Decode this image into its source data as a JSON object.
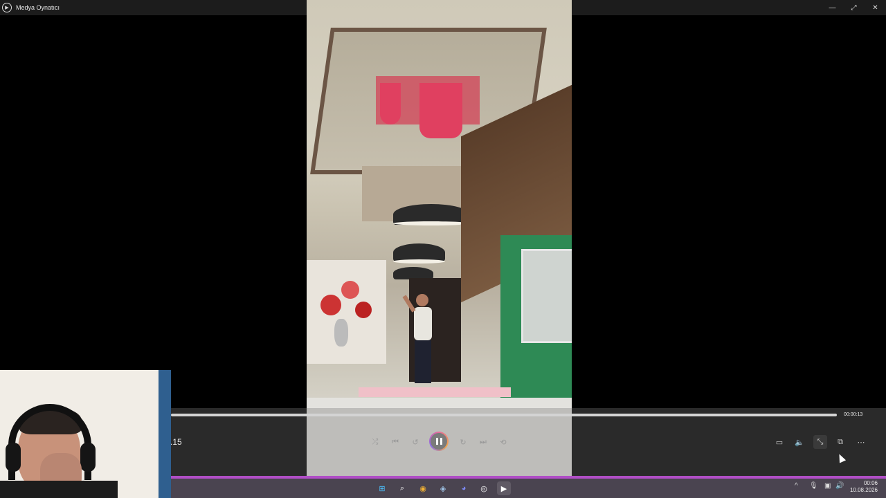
{
  "window": {
    "title": "Medya Oynatıcı",
    "controls": {
      "minimize": "—",
      "restore": "⤢",
      "close": "✕"
    }
  },
  "player": {
    "current_time": ".15",
    "total_time": "00:00:13",
    "progress": 1.0,
    "state": "playing",
    "left_controls": [
      {
        "name": "shuffle-icon",
        "glyph": "⤮"
      },
      {
        "name": "previous-icon",
        "glyph": "⏮"
      },
      {
        "name": "skip-back-10-icon",
        "glyph": "↺"
      }
    ],
    "center_play_pause": "pause-icon",
    "right_playback_controls": [
      {
        "name": "skip-forward-30-icon",
        "glyph": "↻"
      },
      {
        "name": "next-icon",
        "glyph": "⏭"
      },
      {
        "name": "repeat-off-icon",
        "glyph": "⟲"
      }
    ],
    "tool_controls": [
      {
        "name": "subtitles-icon",
        "glyph": "▭"
      },
      {
        "name": "volume-icon",
        "glyph": "🔈"
      },
      {
        "name": "exit-fullscreen-icon",
        "glyph": "⤡"
      },
      {
        "name": "mini-player-icon",
        "glyph": "⧉"
      },
      {
        "name": "more-icon",
        "glyph": "⋯"
      }
    ]
  },
  "taskbar": {
    "apps": [
      {
        "name": "windows-start-icon",
        "glyph": "⊞",
        "color": "#4cc2ff"
      },
      {
        "name": "search-icon",
        "glyph": "⌕",
        "color": "#ffffff"
      },
      {
        "name": "chrome-icon",
        "glyph": "◉",
        "color": "#f2b233"
      },
      {
        "name": "steam-icon",
        "glyph": "◈",
        "color": "#9fc3e6"
      },
      {
        "name": "discord-icon",
        "glyph": "◕",
        "color": "#7d88f0"
      },
      {
        "name": "obs-icon",
        "glyph": "◎",
        "color": "#ffffff"
      },
      {
        "name": "media-player-icon",
        "glyph": "▶",
        "color": "#ffffff"
      }
    ],
    "tray": [
      {
        "name": "chevron-up-icon",
        "glyph": "^"
      },
      {
        "name": "microphone-icon",
        "glyph": "🎙"
      },
      {
        "name": "network-icon",
        "glyph": "▣"
      },
      {
        "name": "speaker-icon",
        "glyph": "🔊"
      }
    ],
    "time": "00:06",
    "date": "10.08.2026",
    "accent_color": "#b04ec6"
  }
}
